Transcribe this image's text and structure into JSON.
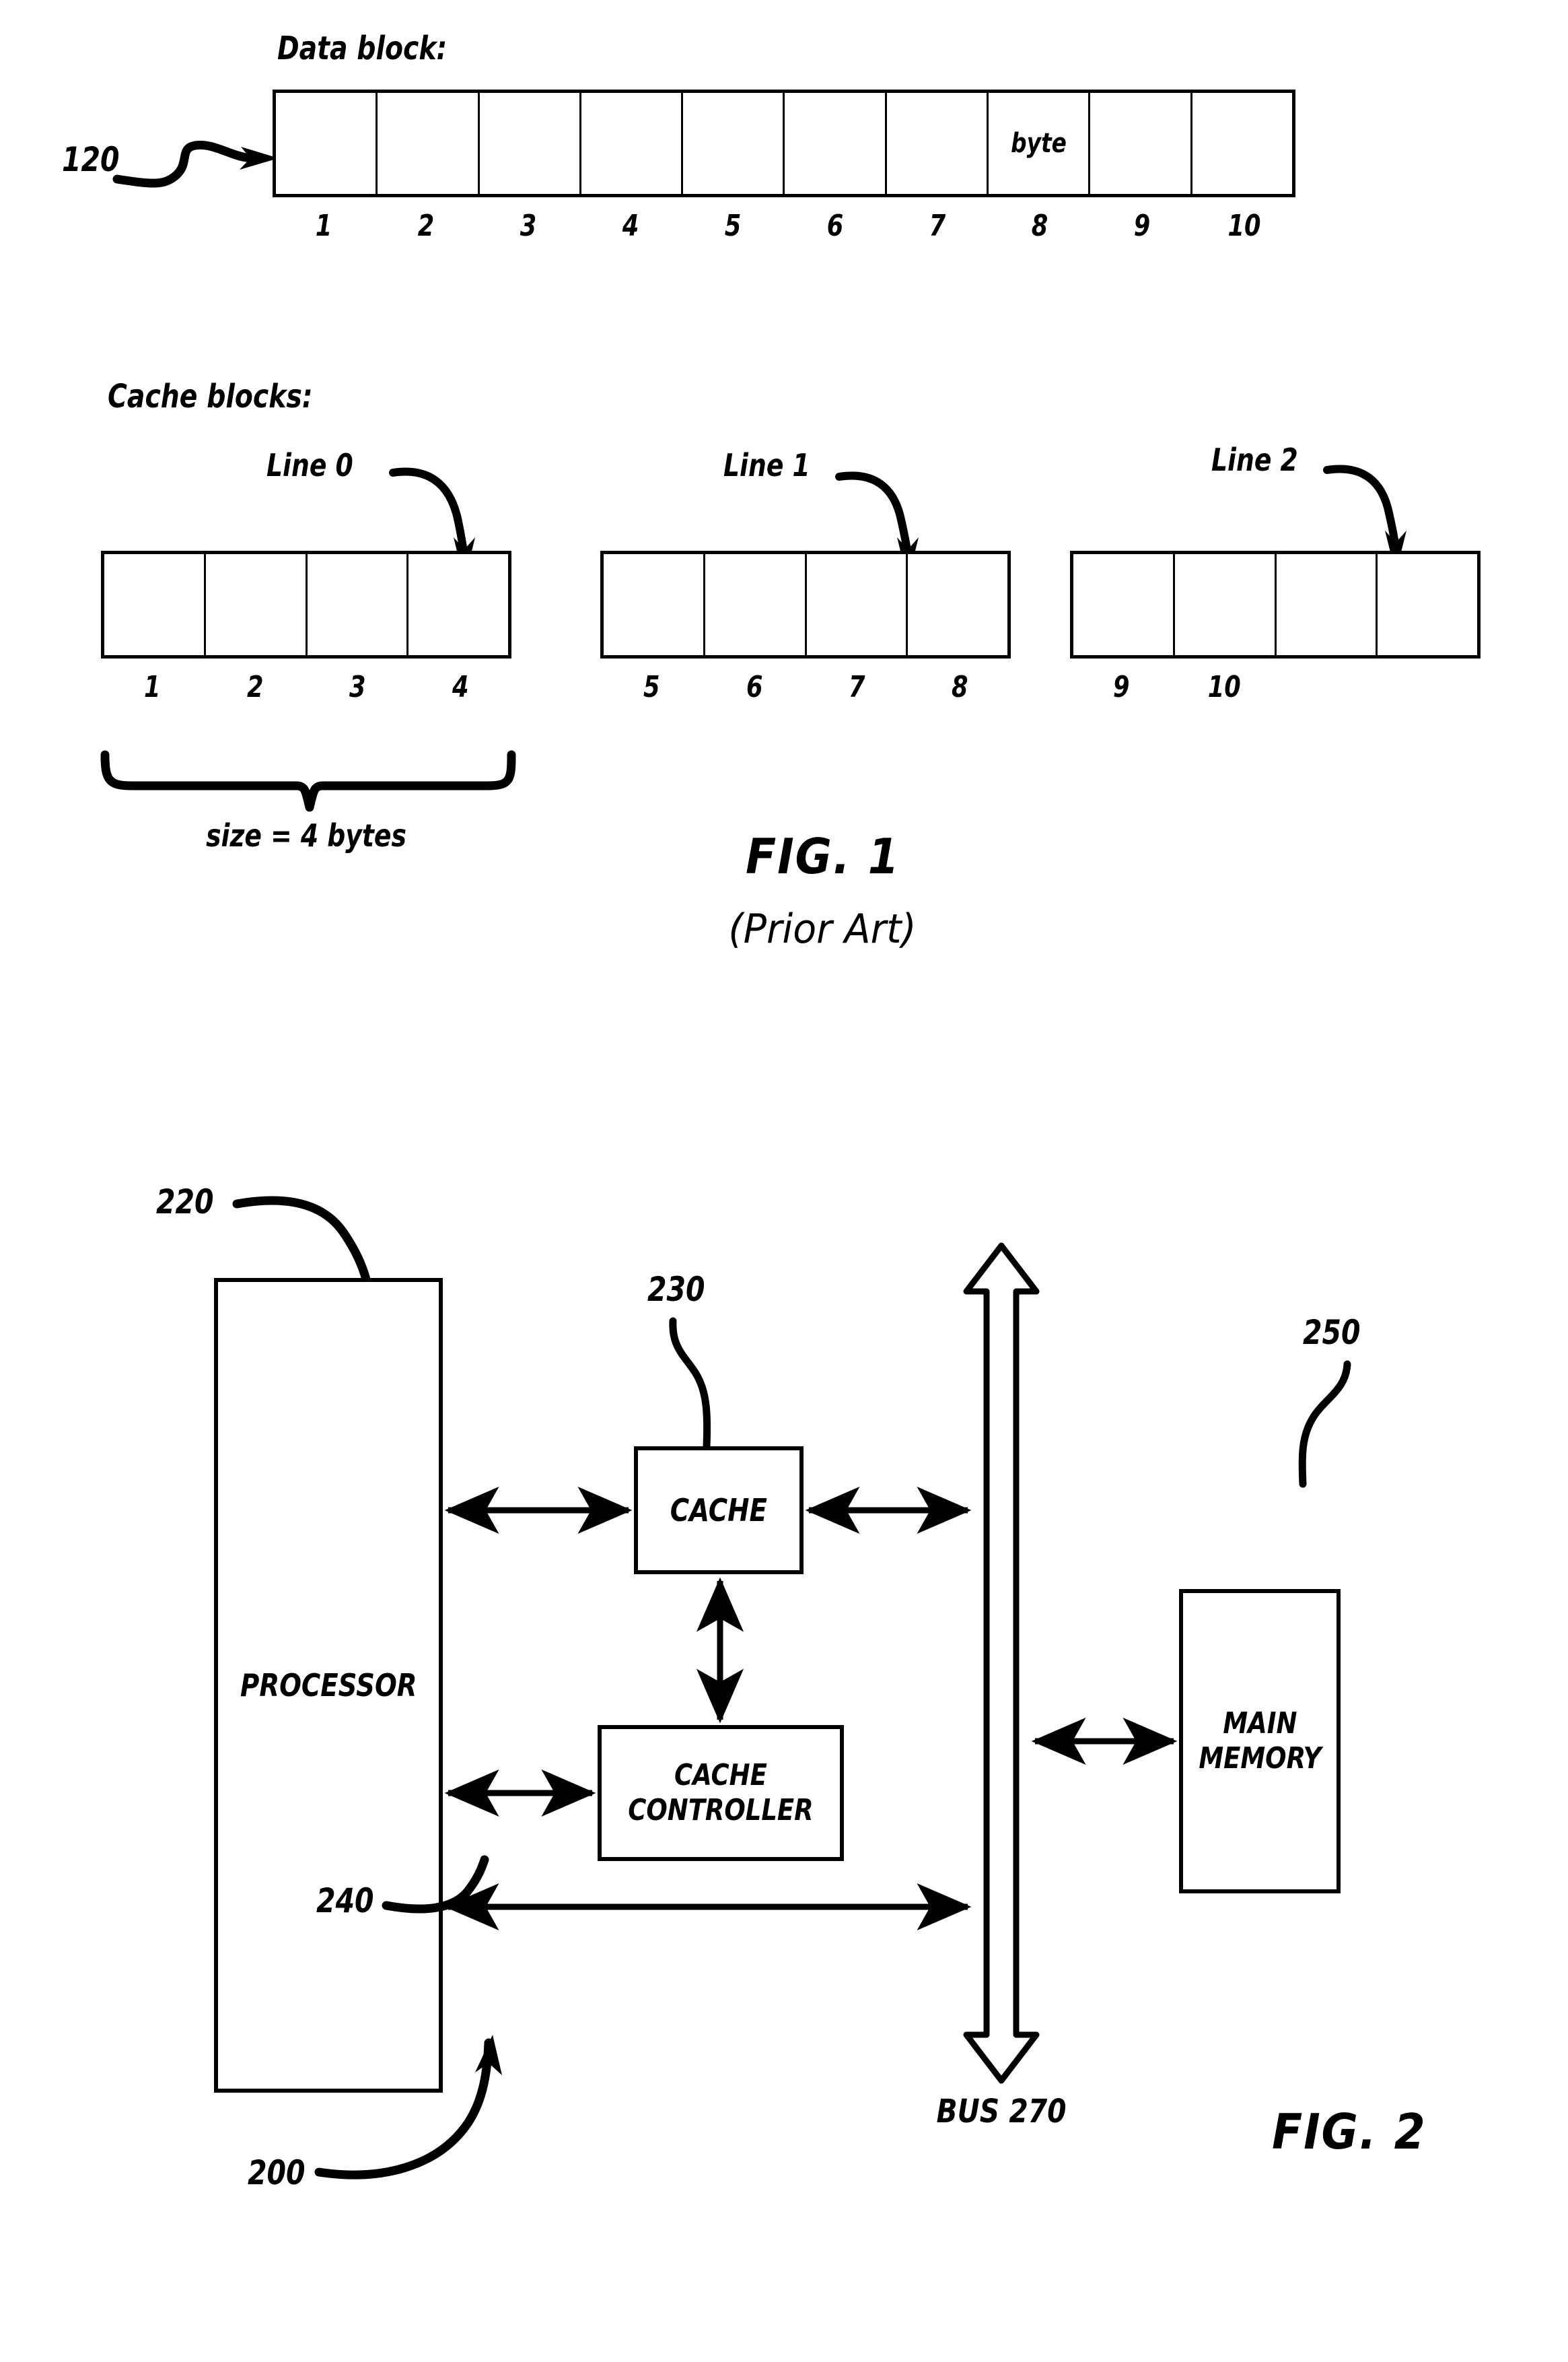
{
  "figure1": {
    "data_block": {
      "title": "Data block:",
      "ref_number": "120",
      "cells": [
        "",
        "",
        "",
        "",
        "",
        "",
        "",
        "byte",
        "",
        ""
      ],
      "numbers": [
        "1",
        "2",
        "3",
        "4",
        "5",
        "6",
        "7",
        "8",
        "9",
        "10"
      ]
    },
    "cache_blocks": {
      "title": "Cache blocks:",
      "lines": [
        {
          "label": "Line 0",
          "cells": [
            "",
            "",
            "",
            ""
          ],
          "numbers": [
            "1",
            "2",
            "3",
            "4"
          ]
        },
        {
          "label": "Line 1",
          "cells": [
            "",
            "",
            "",
            ""
          ],
          "numbers": [
            "5",
            "6",
            "7",
            "8"
          ]
        },
        {
          "label": "Line 2",
          "cells": [
            "",
            "",
            "",
            ""
          ],
          "numbers": [
            "9",
            "10"
          ]
        }
      ],
      "size_note": "size = 4 bytes"
    },
    "caption": "FIG. 1",
    "subcaption": "(Prior Art)"
  },
  "figure2": {
    "system_ref": "200",
    "blocks": {
      "processor": {
        "label": "PROCESSOR",
        "ref_number": "220"
      },
      "cache": {
        "label": "CACHE",
        "ref_number": "230"
      },
      "cache_controller": {
        "label": "CACHE\nCONTROLLER",
        "label_line1": "CACHE",
        "label_line2": "CONTROLLER",
        "ref_number": "240"
      },
      "main_memory": {
        "label": "MAIN\nMEMORY",
        "label_line1": "MAIN",
        "label_line2": "MEMORY",
        "ref_number": "250"
      }
    },
    "bus": {
      "label": "BUS 270"
    },
    "caption": "FIG. 2"
  },
  "colors": {
    "ink": "#000000",
    "paper": "#ffffff"
  }
}
